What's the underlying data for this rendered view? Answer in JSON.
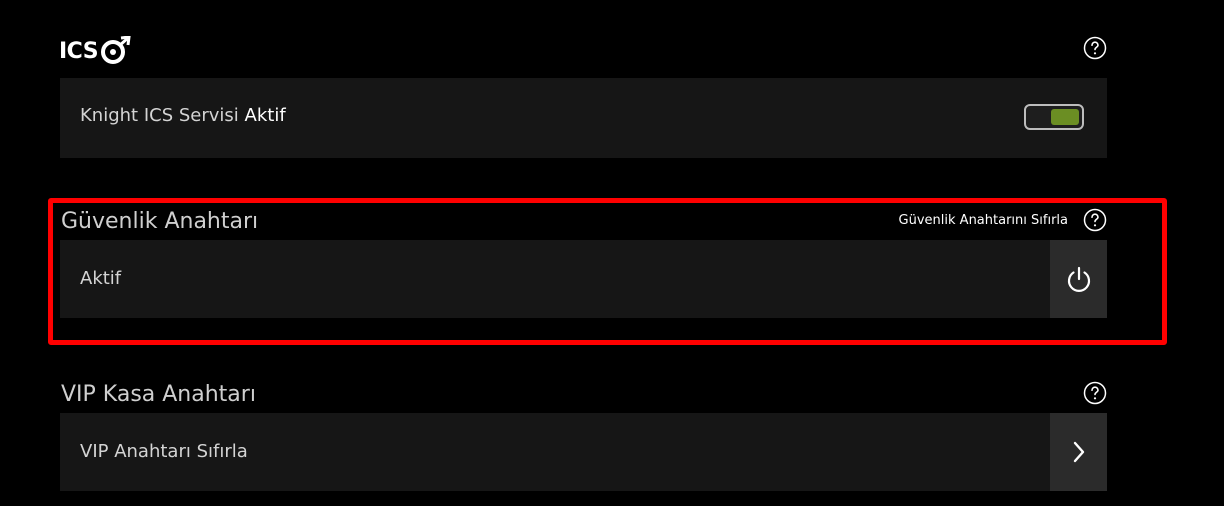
{
  "header": {
    "logo_text": "ICS"
  },
  "service_panel": {
    "label_prefix": "Knight ICS Servisi",
    "label_status": "Aktif",
    "toggle_on": true,
    "toggle_color": "#6b8e23"
  },
  "security_key": {
    "title": "Güvenlik Anahtarı",
    "reset_link": "Güvenlik Anahtarını Sıfırla",
    "status": "Aktif",
    "action_icon": "power-icon"
  },
  "vip_key": {
    "title": "VIP Kasa Anahtarı",
    "row_label": "VIP Anahtarı Sıfırla",
    "action_icon": "chevron-right-icon"
  },
  "colors": {
    "background": "#000000",
    "panel": "#161616",
    "button": "#2b2b2b",
    "highlight": "#ff0000"
  }
}
